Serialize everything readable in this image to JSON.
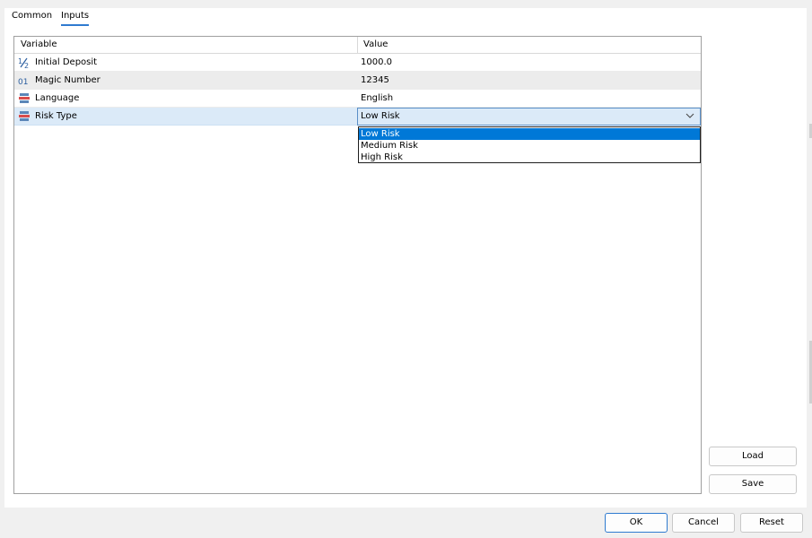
{
  "tabs": [
    {
      "label": "Common"
    },
    {
      "label": "Inputs"
    }
  ],
  "table": {
    "headers": {
      "variable": "Variable",
      "value": "Value"
    },
    "rows": [
      {
        "icon": "fraction-icon",
        "name": "Initial Deposit",
        "value": "1000.0"
      },
      {
        "icon": "integer-icon",
        "name": "Magic Number",
        "value": "12345"
      },
      {
        "icon": "enum-icon",
        "name": "Language",
        "value": "English"
      },
      {
        "icon": "enum-icon",
        "name": "Risk Type",
        "value": "Low Risk"
      }
    ]
  },
  "dropdown": {
    "selected": "Low Risk",
    "options": [
      "Low Risk",
      "Medium Risk",
      "High Risk"
    ]
  },
  "side_buttons": {
    "load": "Load",
    "save": "Save"
  },
  "bottom_buttons": {
    "ok": "OK",
    "cancel": "Cancel",
    "reset": "Reset"
  },
  "colors": {
    "accent": "#0078d7",
    "tab_underline": "#2f7bd0",
    "selected_row": "#dbeaf8"
  }
}
